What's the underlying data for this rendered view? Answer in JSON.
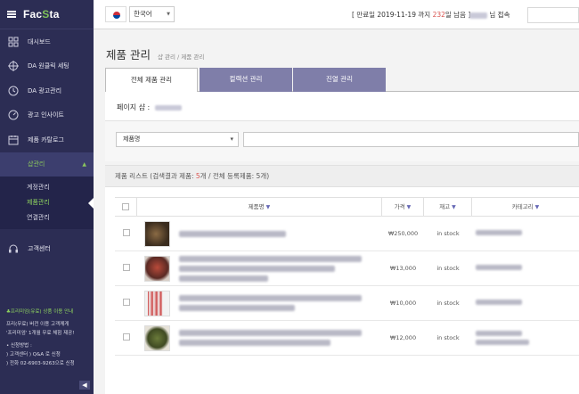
{
  "app": {
    "logo_prefix": "Fac",
    "logo_o": "S",
    "logo_suffix": "ta"
  },
  "sidebar": {
    "items": [
      {
        "label": "대시보드",
        "icon": "dashboard-icon"
      },
      {
        "label": "DA 원클릭 세팅",
        "icon": "crosshair-icon"
      },
      {
        "label": "DA 광고관리",
        "icon": "clock-icon"
      },
      {
        "label": "광고 인사이트",
        "icon": "gauge-icon"
      },
      {
        "label": "제품 카탈로그",
        "icon": "calendar-icon"
      },
      {
        "label": "샵관리",
        "icon": "",
        "expanded": true
      },
      {
        "label": "고객센터",
        "icon": "headset-icon"
      }
    ],
    "sub_items": [
      "계정관리",
      "제품관리",
      "연결관리"
    ],
    "promo": {
      "title": "♣프리미엄(유료) 상품 이용 안내",
      "line1": "프리(무료) 버전 이용 고객께게",
      "line2": "'프리미엄' 1개월 무료 체험 제공!",
      "line3": "• 신청방법 :",
      "line4": ") 고객센터 ) Q&A 로 신청",
      "line5": ") 전화 02-6903-9263으로 신청"
    },
    "collapse_label": "◀"
  },
  "topbar": {
    "language": "한국어",
    "expire_prefix": "[ 만료일 2019-11-19 까지 ",
    "expire_days": "232",
    "expire_suffix": "일 남음 ]",
    "user_suffix": "님 접속"
  },
  "page": {
    "title": "제품 관리",
    "breadcrumb": "샵 관리 / 제품 관리",
    "tabs": [
      "전체 제품 관리",
      "컬렉션 관리",
      "진열 관리"
    ],
    "active_tab": 0,
    "shop_label": "페이지 샵 :"
  },
  "filter": {
    "select_value": "제품명",
    "select_arrow": "▾"
  },
  "list": {
    "header_prefix": "제품 리스트 (검색결과 제품: ",
    "search_count": "5",
    "header_mid": "개 / 전체 등록제품: 5개)",
    "columns": [
      "제품명",
      "가격",
      "재고",
      "카테고리"
    ],
    "rows": [
      {
        "price": "₩250,000",
        "stock": "in stock"
      },
      {
        "price": "₩13,000",
        "stock": "in stock"
      },
      {
        "price": "₩10,000",
        "stock": "in stock"
      },
      {
        "price": "₩12,000",
        "stock": "in stock"
      }
    ]
  },
  "colors": {
    "sidebar_bg": "#2c2d54",
    "accent_green": "#8fd35f",
    "tab_purple": "#7f7ea9",
    "count_red": "#d9534f"
  }
}
